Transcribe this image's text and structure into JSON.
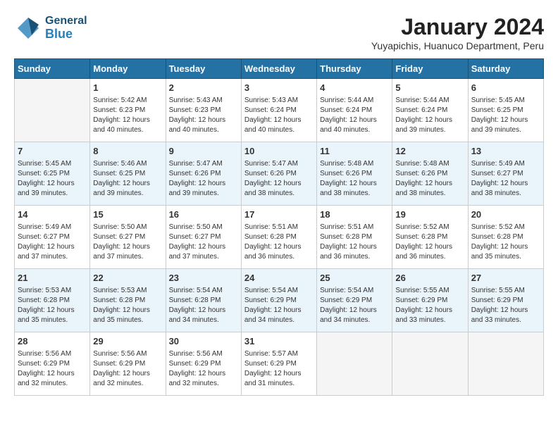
{
  "header": {
    "logo_general": "General",
    "logo_blue": "Blue",
    "title": "January 2024",
    "location": "Yuyapichis, Huanuco Department, Peru"
  },
  "days_of_week": [
    "Sunday",
    "Monday",
    "Tuesday",
    "Wednesday",
    "Thursday",
    "Friday",
    "Saturday"
  ],
  "weeks": [
    [
      {
        "day": "",
        "info": ""
      },
      {
        "day": "1",
        "info": "Sunrise: 5:42 AM\nSunset: 6:23 PM\nDaylight: 12 hours\nand 40 minutes."
      },
      {
        "day": "2",
        "info": "Sunrise: 5:43 AM\nSunset: 6:23 PM\nDaylight: 12 hours\nand 40 minutes."
      },
      {
        "day": "3",
        "info": "Sunrise: 5:43 AM\nSunset: 6:24 PM\nDaylight: 12 hours\nand 40 minutes."
      },
      {
        "day": "4",
        "info": "Sunrise: 5:44 AM\nSunset: 6:24 PM\nDaylight: 12 hours\nand 40 minutes."
      },
      {
        "day": "5",
        "info": "Sunrise: 5:44 AM\nSunset: 6:24 PM\nDaylight: 12 hours\nand 39 minutes."
      },
      {
        "day": "6",
        "info": "Sunrise: 5:45 AM\nSunset: 6:25 PM\nDaylight: 12 hours\nand 39 minutes."
      }
    ],
    [
      {
        "day": "7",
        "info": "Sunrise: 5:45 AM\nSunset: 6:25 PM\nDaylight: 12 hours\nand 39 minutes."
      },
      {
        "day": "8",
        "info": "Sunrise: 5:46 AM\nSunset: 6:25 PM\nDaylight: 12 hours\nand 39 minutes."
      },
      {
        "day": "9",
        "info": "Sunrise: 5:47 AM\nSunset: 6:26 PM\nDaylight: 12 hours\nand 39 minutes."
      },
      {
        "day": "10",
        "info": "Sunrise: 5:47 AM\nSunset: 6:26 PM\nDaylight: 12 hours\nand 38 minutes."
      },
      {
        "day": "11",
        "info": "Sunrise: 5:48 AM\nSunset: 6:26 PM\nDaylight: 12 hours\nand 38 minutes."
      },
      {
        "day": "12",
        "info": "Sunrise: 5:48 AM\nSunset: 6:26 PM\nDaylight: 12 hours\nand 38 minutes."
      },
      {
        "day": "13",
        "info": "Sunrise: 5:49 AM\nSunset: 6:27 PM\nDaylight: 12 hours\nand 38 minutes."
      }
    ],
    [
      {
        "day": "14",
        "info": "Sunrise: 5:49 AM\nSunset: 6:27 PM\nDaylight: 12 hours\nand 37 minutes."
      },
      {
        "day": "15",
        "info": "Sunrise: 5:50 AM\nSunset: 6:27 PM\nDaylight: 12 hours\nand 37 minutes."
      },
      {
        "day": "16",
        "info": "Sunrise: 5:50 AM\nSunset: 6:27 PM\nDaylight: 12 hours\nand 37 minutes."
      },
      {
        "day": "17",
        "info": "Sunrise: 5:51 AM\nSunset: 6:28 PM\nDaylight: 12 hours\nand 36 minutes."
      },
      {
        "day": "18",
        "info": "Sunrise: 5:51 AM\nSunset: 6:28 PM\nDaylight: 12 hours\nand 36 minutes."
      },
      {
        "day": "19",
        "info": "Sunrise: 5:52 AM\nSunset: 6:28 PM\nDaylight: 12 hours\nand 36 minutes."
      },
      {
        "day": "20",
        "info": "Sunrise: 5:52 AM\nSunset: 6:28 PM\nDaylight: 12 hours\nand 35 minutes."
      }
    ],
    [
      {
        "day": "21",
        "info": "Sunrise: 5:53 AM\nSunset: 6:28 PM\nDaylight: 12 hours\nand 35 minutes."
      },
      {
        "day": "22",
        "info": "Sunrise: 5:53 AM\nSunset: 6:28 PM\nDaylight: 12 hours\nand 35 minutes."
      },
      {
        "day": "23",
        "info": "Sunrise: 5:54 AM\nSunset: 6:28 PM\nDaylight: 12 hours\nand 34 minutes."
      },
      {
        "day": "24",
        "info": "Sunrise: 5:54 AM\nSunset: 6:29 PM\nDaylight: 12 hours\nand 34 minutes."
      },
      {
        "day": "25",
        "info": "Sunrise: 5:54 AM\nSunset: 6:29 PM\nDaylight: 12 hours\nand 34 minutes."
      },
      {
        "day": "26",
        "info": "Sunrise: 5:55 AM\nSunset: 6:29 PM\nDaylight: 12 hours\nand 33 minutes."
      },
      {
        "day": "27",
        "info": "Sunrise: 5:55 AM\nSunset: 6:29 PM\nDaylight: 12 hours\nand 33 minutes."
      }
    ],
    [
      {
        "day": "28",
        "info": "Sunrise: 5:56 AM\nSunset: 6:29 PM\nDaylight: 12 hours\nand 32 minutes."
      },
      {
        "day": "29",
        "info": "Sunrise: 5:56 AM\nSunset: 6:29 PM\nDaylight: 12 hours\nand 32 minutes."
      },
      {
        "day": "30",
        "info": "Sunrise: 5:56 AM\nSunset: 6:29 PM\nDaylight: 12 hours\nand 32 minutes."
      },
      {
        "day": "31",
        "info": "Sunrise: 5:57 AM\nSunset: 6:29 PM\nDaylight: 12 hours\nand 31 minutes."
      },
      {
        "day": "",
        "info": ""
      },
      {
        "day": "",
        "info": ""
      },
      {
        "day": "",
        "info": ""
      }
    ]
  ]
}
